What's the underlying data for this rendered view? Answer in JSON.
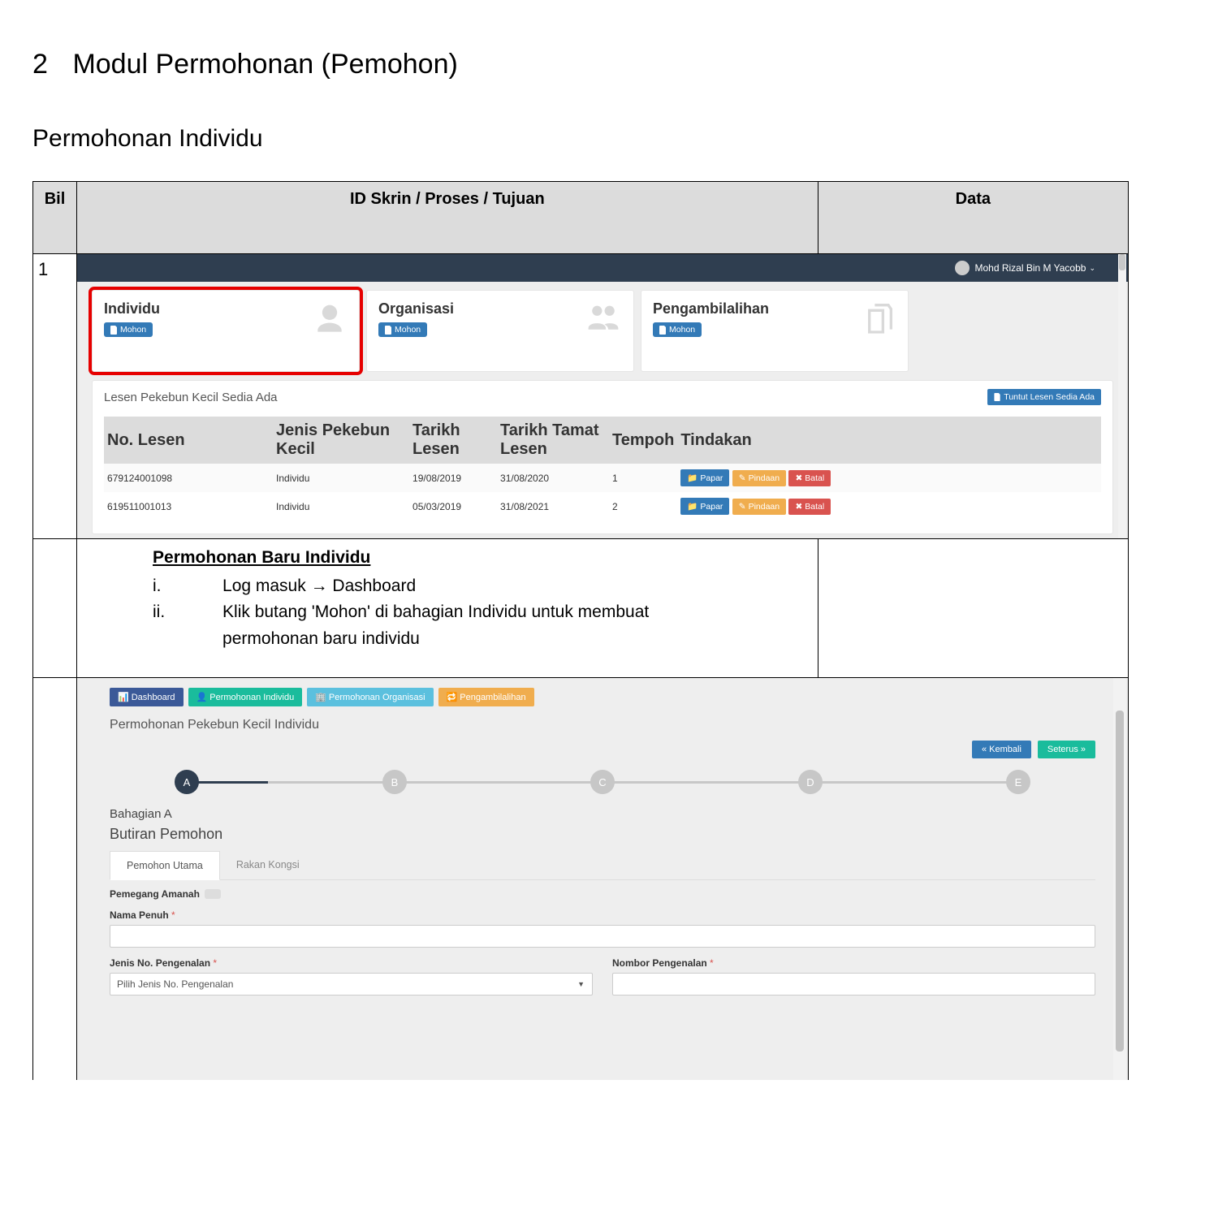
{
  "heading": {
    "num": "2",
    "text": "Modul Permohonan (Pemohon)"
  },
  "subheading": "Permohonan Individu",
  "columns": {
    "bil": "Bil",
    "mid": "ID Skrin / Proses / Tujuan",
    "data": "Data"
  },
  "row1_bil": "1",
  "topbar_user": "Mohd Rizal Bin M Yacobb",
  "cards": [
    {
      "title": "Individu",
      "btn": "Mohon"
    },
    {
      "title": "Organisasi",
      "btn": "Mohon"
    },
    {
      "title": "Pengambilalihan",
      "btn": "Mohon"
    }
  ],
  "panel_title": "Lesen Pekebun Kecil Sedia Ada",
  "panel_btn": "Tuntut Lesen Sedia Ada",
  "lic_headers": [
    "No. Lesen",
    "Jenis Pekebun Kecil",
    "Tarikh Lesen",
    "Tarikh Tamat Lesen",
    "Tempoh",
    "Tindakan"
  ],
  "lic_rows": [
    {
      "no": "679124001098",
      "jenis": "Individu",
      "t1": "19/08/2019",
      "t2": "31/08/2020",
      "tp": "1"
    },
    {
      "no": "619511001013",
      "jenis": "Individu",
      "t1": "05/03/2019",
      "t2": "31/08/2021",
      "tp": "2"
    }
  ],
  "act_btns": {
    "paper": "Papar",
    "pindaan": "Pindaan",
    "batal": "Batal"
  },
  "instr": {
    "title": "Permohonan Baru Individu",
    "items": [
      {
        "n": "i.",
        "t": "Log masuk → Dashboard"
      },
      {
        "n": "ii.",
        "t": "Klik butang 'Mohon' di bahagian Individu untuk membuat permohonan baru individu"
      }
    ]
  },
  "nav": [
    "Dashboard",
    "Permohonan Individu",
    "Permohonan Organisasi",
    "Pengambilalihan"
  ],
  "page2_title": "Permohonan Pekebun Kecil Individu",
  "page2_btns": {
    "back": "« Kembali",
    "next": "Seterus »"
  },
  "steps": [
    "A",
    "B",
    "C",
    "D",
    "E"
  ],
  "sectA": "Bahagian A",
  "sectA2": "Butiran Pemohon",
  "tabs": [
    "Pemohon Utama",
    "Rakan Kongsi"
  ],
  "trustee": "Pemegang Amanah",
  "fields": {
    "nama": "Nama Penuh",
    "jenisid": "Jenis No. Pengenalan",
    "jenisid_ph": "Pilih Jenis No. Pengenalan",
    "noid": "Nombor Pengenalan"
  }
}
